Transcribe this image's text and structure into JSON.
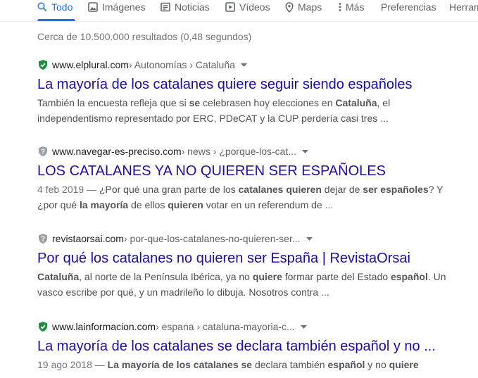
{
  "tabs": [
    {
      "label": "Todo",
      "icon": "search-icon",
      "active": true
    },
    {
      "label": "Imágenes",
      "icon": "image-icon",
      "active": false
    },
    {
      "label": "Noticias",
      "icon": "news-icon",
      "active": false
    },
    {
      "label": "Vídeos",
      "icon": "video-icon",
      "active": false
    },
    {
      "label": "Maps",
      "icon": "map-pin-icon",
      "active": false
    },
    {
      "label": "Más",
      "icon": "more-vertical-icon",
      "active": false
    },
    {
      "label": "Preferencias",
      "active": false
    },
    {
      "label": "Herram",
      "active": false
    }
  ],
  "stats": "Cerca de 10.500.000 resultados (0,48 segundos)",
  "colors": {
    "accent": "#1a73e8",
    "link": "#1a0dab",
    "secure_shield": "#1e8e3e",
    "neutral_shield": "#9aa0a6"
  },
  "results": [
    {
      "domain": "www.elplural.com",
      "path": " › Autonomías › Cataluña",
      "shield": "secure",
      "title": "La mayoría de los catalanes quiere seguir siendo españoles",
      "snippet": [
        {
          "t": "También la encuesta refleja que si "
        },
        {
          "t": "se",
          "b": true
        },
        {
          "t": " celebrasen hoy elecciones en "
        },
        {
          "t": "Cataluña",
          "b": true
        },
        {
          "t": ", el independentismo representado por ERC, PDeCAT y la CUP perdería casi tres ..."
        }
      ]
    },
    {
      "domain": "www.navegar-es-preciso.com",
      "path": " › news › ¿porque-los-cat...",
      "shield": "neutral",
      "title": "LOS CATALANES YA NO QUIEREN SER ESPAÑOLES",
      "date": "4 feb 2019 — ",
      "snippet": [
        {
          "t": "¿Por qué una gran parte de los "
        },
        {
          "t": "catalanes quieren",
          "b": true
        },
        {
          "t": " dejar de "
        },
        {
          "t": "ser españoles",
          "b": true
        },
        {
          "t": "? Y ¿por qué "
        },
        {
          "t": "la mayoría",
          "b": true
        },
        {
          "t": " de ellos "
        },
        {
          "t": "quieren",
          "b": true
        },
        {
          "t": " votar en un referendum de ..."
        }
      ]
    },
    {
      "domain": "revistaorsai.com",
      "path": " › por-que-los-catalanes-no-quieren-ser...",
      "shield": "neutral",
      "title": "Por qué los catalanes no quieren ser España | RevistaOrsai",
      "snippet": [
        {
          "t": "Cataluña",
          "b": true
        },
        {
          "t": ", al norte de la Península Ibérica, ya no "
        },
        {
          "t": "quiere",
          "b": true
        },
        {
          "t": " formar parte del Estado "
        },
        {
          "t": "español",
          "b": true
        },
        {
          "t": ". Un vasco escribe por qué, y un madrileño lo dibuja. Nosotros contra ..."
        }
      ]
    },
    {
      "domain": "www.lainformacion.com",
      "path": " › espana › cataluna-mayoria-c...",
      "shield": "secure",
      "title": "La mayoría de los catalanes se declara también español y no ...",
      "date": "19 ago 2018 — ",
      "snippet": [
        {
          "t": "La mayoría de los catalanes se",
          "b": true
        },
        {
          "t": " declara también "
        },
        {
          "t": "español",
          "b": true
        },
        {
          "t": " y no "
        },
        {
          "t": "quiere",
          "b": true
        }
      ]
    }
  ]
}
